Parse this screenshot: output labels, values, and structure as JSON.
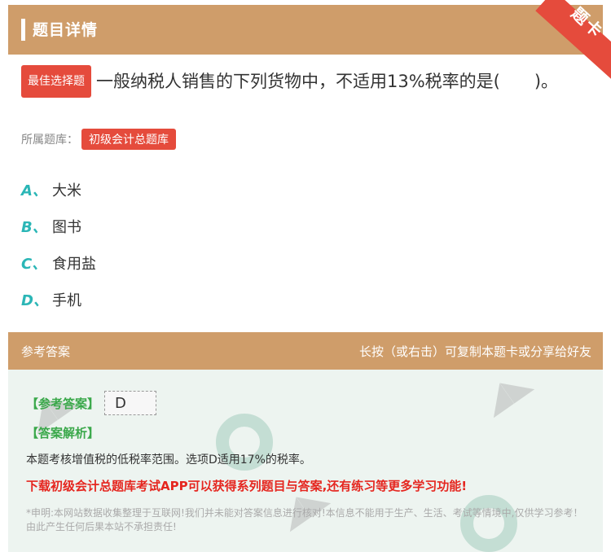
{
  "header": {
    "title": "题目详情",
    "ribbon": "题卡"
  },
  "question": {
    "type_badge": "最佳选择题",
    "text": "一般纳税人销售的下列货物中，不适用13%税率的是(　　)。",
    "library_label": "所属题库：",
    "library_name": "初级会计总题库"
  },
  "options": [
    {
      "letter": "A、",
      "text": "大米"
    },
    {
      "letter": "B、",
      "text": "图书"
    },
    {
      "letter": "C、",
      "text": "食用盐"
    },
    {
      "letter": "D、",
      "text": "手机"
    }
  ],
  "answer_panel": {
    "header_left": "参考答案",
    "header_right": "长按（或右击）可复制本题卡或分享给好友",
    "ref_label": "【参考答案】",
    "ref_value": "D",
    "analysis_label": "【答案解析】",
    "analysis_text": "本题考核增值税的低税率范围。选项D适用17%的税率。",
    "promo": "下载初级会计总题库考试APP可以获得系列题目与答案,还有练习等更多学习功能!",
    "disclaimer": "*申明:本网站数据收集整理于互联网!我们并未能对答案信息进行核对!本信息不能用于生产、生活、考试等情境中,仅供学习参考！由此产生任何后果本站不承担责任!"
  },
  "colors": {
    "header": "#cf9d6a",
    "badge": "#e54b3c",
    "option_letter": "#2bb6b6",
    "green": "#3aa84a",
    "promo": "#e5261f"
  }
}
